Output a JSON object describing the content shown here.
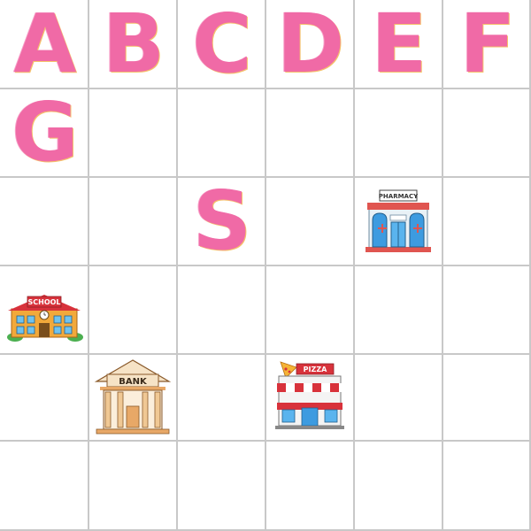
{
  "colors": {
    "letter_fill": "#f06aa6",
    "grid_line": "#c8c8c8",
    "background": "#ffffff"
  },
  "grid": {
    "columns": 6,
    "rows": 6
  },
  "letters": [
    {
      "text": "A",
      "col": 0,
      "row": 0
    },
    {
      "text": "B",
      "col": 1,
      "row": 0
    },
    {
      "text": "C",
      "col": 2,
      "row": 0
    },
    {
      "text": "D",
      "col": 3,
      "row": 0
    },
    {
      "text": "E",
      "col": 4,
      "row": 0
    },
    {
      "text": "F",
      "col": 5,
      "row": 0
    },
    {
      "text": "G",
      "col": 0,
      "row": 1
    },
    {
      "text": "S",
      "col": 2,
      "row": 2
    }
  ],
  "buildings": {
    "pharmacy": {
      "sign": "PHARMACY",
      "icon": "pharmacy-building-icon",
      "col": 4,
      "row": 2
    },
    "school": {
      "sign": "SCHOOL",
      "icon": "school-building-icon",
      "col": 0,
      "row": 3
    },
    "bank": {
      "sign": "BANK",
      "icon": "bank-building-icon",
      "col": 1,
      "row": 4
    },
    "pizza": {
      "sign": "PIZZA",
      "icon": "pizza-shop-icon",
      "col": 3,
      "row": 4
    }
  }
}
